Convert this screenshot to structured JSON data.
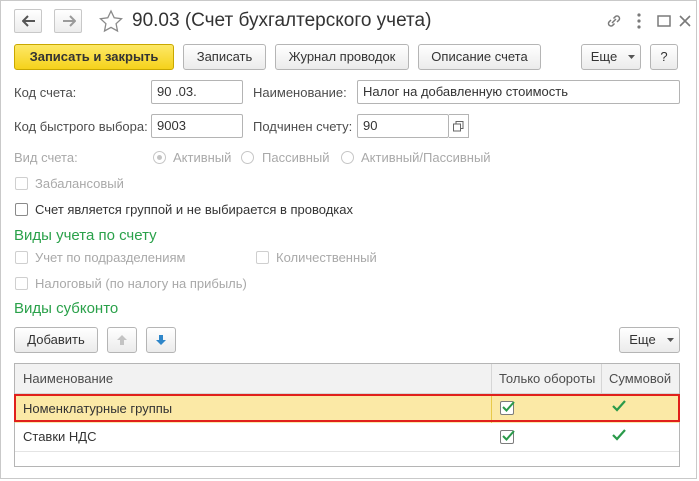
{
  "window": {
    "title": "90.03 (Счет бухгалтерского учета)"
  },
  "toolbar": {
    "save_close": "Записать и закрыть",
    "save": "Записать",
    "journal": "Журнал проводок",
    "description": "Описание счета",
    "more": "Еще",
    "help": "?"
  },
  "form": {
    "account_code_label": "Код счета:",
    "account_code_value": "90 .03.",
    "name_label": "Наименование:",
    "name_value": "Налог на добавленную стоимость",
    "quick_code_label": "Код быстрого выбора:",
    "quick_code_value": "9003",
    "parent_label": "Подчинен счету:",
    "parent_value": "90",
    "type_label": "Вид счета:",
    "type_options": [
      "Активный",
      "Пассивный",
      "Активный/Пассивный"
    ],
    "off_balance_label": "Забалансовый",
    "is_group_label": "Счет является группой и не выбирается в проводках"
  },
  "accounting_section": {
    "title": "Виды учета по счету",
    "by_department": "Учет по подразделениям",
    "quantitative": "Количественный",
    "tax": "Налоговый (по налогу на прибыль)"
  },
  "subconto_section": {
    "title": "Виды субконто",
    "add": "Добавить",
    "more": "Еще"
  },
  "table": {
    "headers": [
      "Наименование",
      "Только обороты",
      "Суммовой"
    ],
    "rows": [
      {
        "name": "Номенклатурные группы",
        "turnover_only": true,
        "sum": true
      },
      {
        "name": "Ставки НДС",
        "turnover_only": true,
        "sum": true
      }
    ]
  },
  "colors": {
    "primary_button": "#f5d21b",
    "section_title": "#2aa14a",
    "selected_row": "#fbe9a6",
    "highlight_border": "#e0201b",
    "check": "#2a9a4a"
  }
}
